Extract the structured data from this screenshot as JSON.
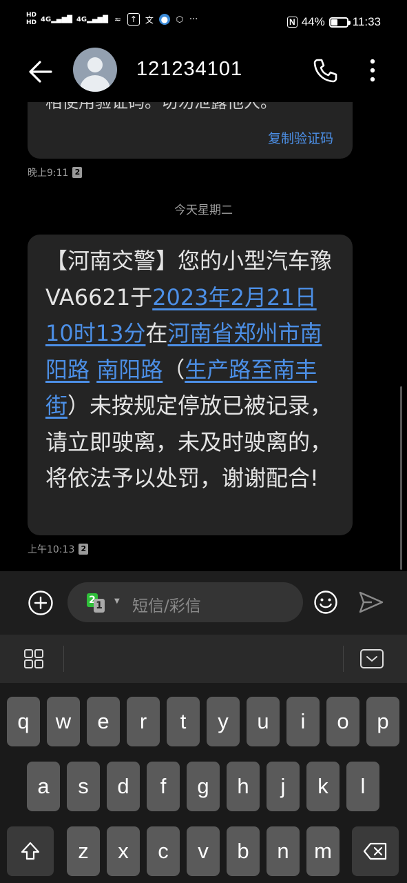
{
  "status_bar": {
    "hd_1": "HD",
    "hd_2": "HD",
    "sim1_net": "4G",
    "sim2_net": "4G",
    "nfc": "N",
    "battery_level": 44,
    "battery_text": "44%",
    "time": "11:33",
    "more": "···"
  },
  "header": {
    "contact": "121234101"
  },
  "messages": {
    "prev_fragment": "相使用验证码。切勿泄露他人。",
    "copy_code_label": "复制验证码",
    "prev_time": "晚上9:11",
    "sim_badge": "2",
    "date_separator": "今天星期二",
    "main": {
      "p1": "【河南交警】您的小型汽车豫VA6621于",
      "link_date": "2023年2月21日10时13分",
      "p2": "在",
      "link_loc1": "河南省郑州市南阳路",
      "p3": " ",
      "link_loc2": "南阳路",
      "p4": "（",
      "link_loc3": "生产路至南丰街",
      "p5": "）未按规定停放已被记录，请立即驶离，未及时驶离的，将依法予以处罚，谢谢配合!"
    },
    "main_time": "上午10:13"
  },
  "input": {
    "sim_top": "2",
    "sim_bottom": "1",
    "placeholder": "短信/彩信"
  },
  "keyboard": {
    "row1": [
      "q",
      "w",
      "e",
      "r",
      "t",
      "y",
      "u",
      "i",
      "o",
      "p"
    ],
    "row2": [
      "a",
      "s",
      "d",
      "f",
      "g",
      "h",
      "j",
      "k",
      "l"
    ],
    "row3": [
      "z",
      "x",
      "c",
      "v",
      "b",
      "n",
      "m"
    ]
  }
}
